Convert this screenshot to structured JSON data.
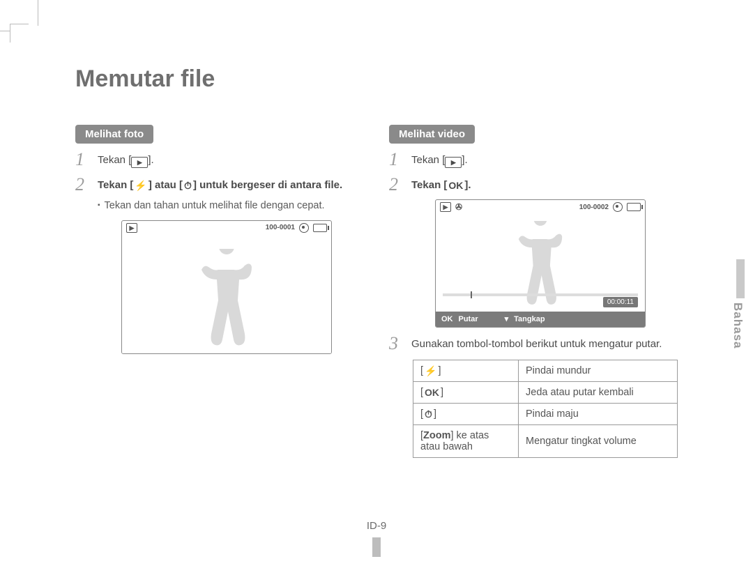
{
  "title": "Memutar file",
  "side_tab": "Bahasa",
  "page_label": "ID-9",
  "icons": {
    "play_box": "▶",
    "flash": "⚡",
    "timer": "⏱",
    "ok": "OK",
    "down": "▾"
  },
  "left": {
    "heading": "Melihat foto",
    "step1_a": "Tekan [",
    "step1_b": "].",
    "step2_a": "Tekan [",
    "step2_b": "] atau [",
    "step2_c": "] untuk bergeser di antara file.",
    "sub": "Tekan dan tahan untuk melihat file dengan cepat.",
    "lcd_counter": "100-0001"
  },
  "right": {
    "heading": "Melihat video",
    "step1_a": "Tekan [",
    "step1_b": "].",
    "step2_a": "Tekan [",
    "step2_b": "].",
    "step3": "Gunakan tombol-tombol berikut untuk mengatur putar.",
    "lcd_counter": "100-0002",
    "lcd_time": "00:00:11",
    "lcd_foot_ok": "OK",
    "lcd_foot_play": "Putar",
    "lcd_foot_cap": "Tangkap"
  },
  "table": {
    "rows": [
      {
        "key_pre": "[",
        "key_icon": "flash",
        "key_post": "]",
        "val": "Pindai mundur"
      },
      {
        "key_pre": "[",
        "key_icon": "ok",
        "key_post": "]",
        "val": "Jeda atau putar kembali"
      },
      {
        "key_pre": "[",
        "key_icon": "timer",
        "key_post": "]",
        "val": "Pindai maju"
      },
      {
        "key_html": "zoom",
        "zoom_bold": "Zoom",
        "zoom_rest": " ke atas atau bawah",
        "val": "Mengatur tingkat volume"
      }
    ]
  }
}
